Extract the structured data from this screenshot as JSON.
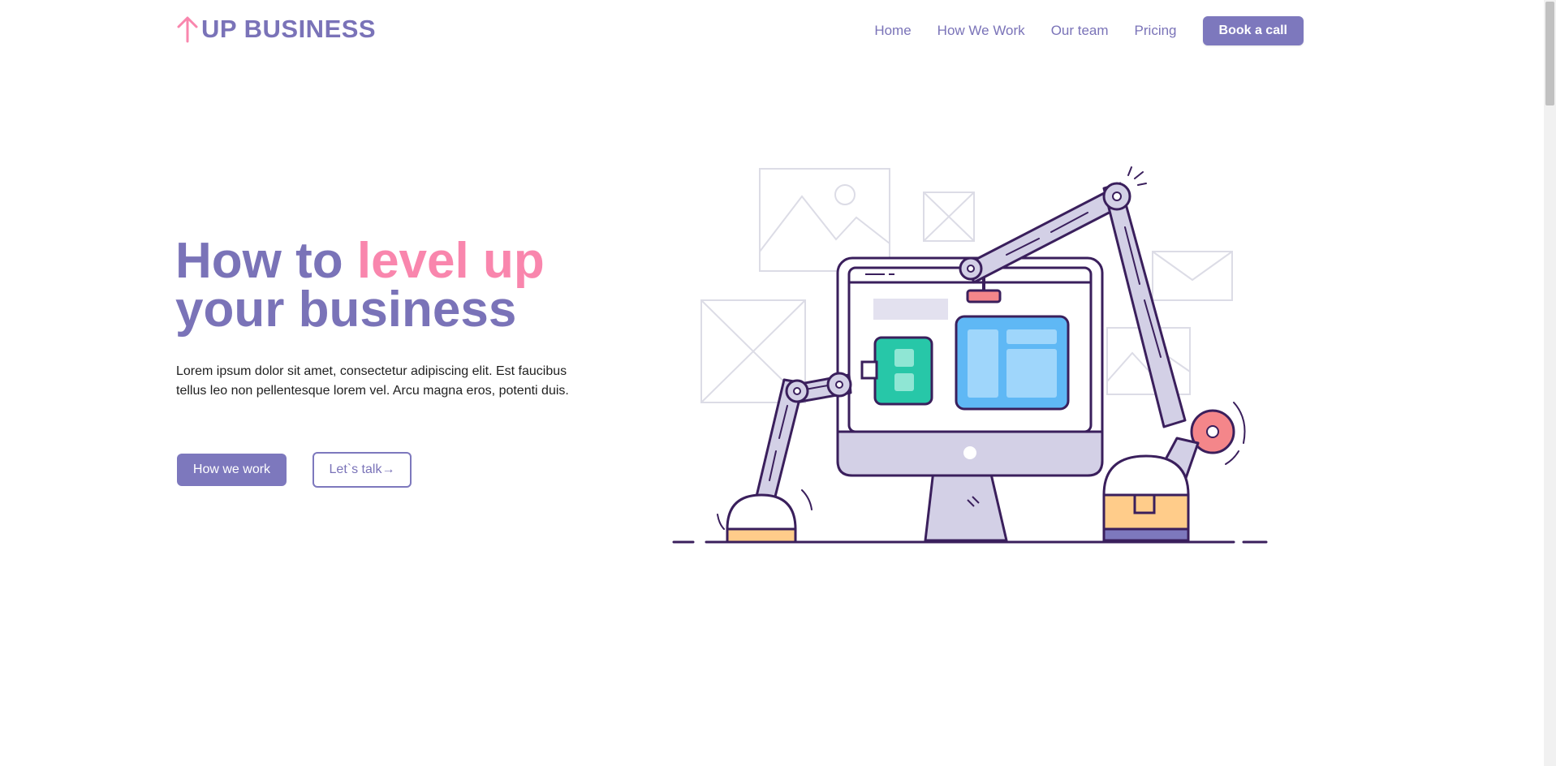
{
  "brand": {
    "name": "UP BUSINESS"
  },
  "nav": {
    "items": [
      {
        "label": "Home"
      },
      {
        "label": "How We Work"
      },
      {
        "label": "Our team"
      },
      {
        "label": "Pricing"
      }
    ],
    "cta_label": "Book a call"
  },
  "hero": {
    "title_part1": "How to ",
    "title_accent": "level up",
    "title_part2": "your business",
    "text": "Lorem ipsum dolor sit amet, consectetur adipiscing elit. Est faucibus tellus leo non pellentesque lorem vel. Arcu magna eros, potenti duis.",
    "primary_button": "How we work",
    "secondary_button": "Let`s talk"
  },
  "colors": {
    "brand_purple": "#7d78bd",
    "accent_pink": "#f986ad",
    "outline": "#3a1f5c",
    "monitor": "#d3d0e6"
  }
}
